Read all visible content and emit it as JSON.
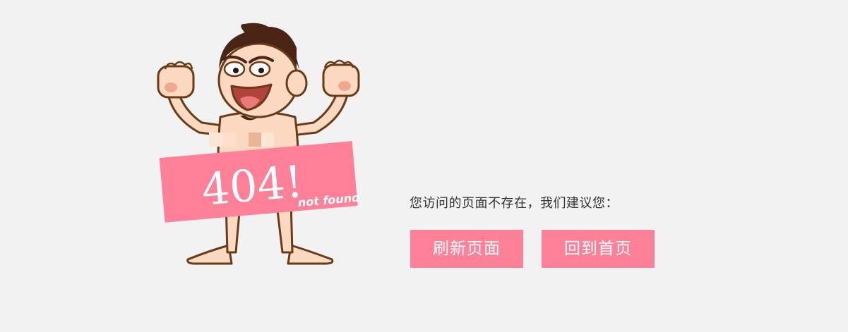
{
  "illustration": {
    "code": "404!",
    "caption": "not found",
    "colors": {
      "sign": "#ff8099",
      "skin": "#fcd9c0",
      "outline": "#6b3a17",
      "hair": "#4a2515"
    }
  },
  "message": "您访问的页面不存在，我们建议您：",
  "buttons": {
    "refresh": "刷新页面",
    "home": "回到首页"
  },
  "colors": {
    "background": "#f3f2f2",
    "button": "#ff8099",
    "text": "#333333"
  }
}
